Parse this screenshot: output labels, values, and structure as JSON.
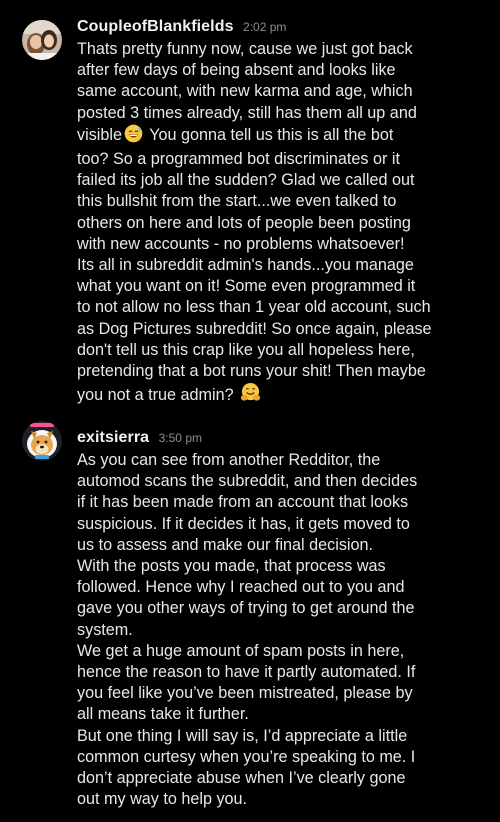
{
  "colors": {
    "background": "#000000",
    "username": "#f2f2f2",
    "timestamp": "#8e8e8e",
    "text": "#e8e8e8"
  },
  "messages": [
    {
      "username": "CoupleofBlankfields",
      "time": "2:02 pm",
      "avatar_icon": "couple-photo-avatar",
      "lines": [
        "Thats pretty funny now, cause we just got back",
        "after few days of being absent and looks like",
        "same account, with new karma and age, which",
        "posted 3 times already, still has them all up and",
        "visible",
        " You gonna tell us this is all the bot",
        "too? So a programmed bot discriminates or it",
        "failed its job all the sudden? Glad we called out",
        "this bullshit from the start...we even talked to",
        "others on here and lots of people been posting",
        "with new accounts - no problems whatsoever!",
        "Its all in subreddit admin's hands...you manage",
        "what you want on it! Some even programmed it",
        "to not allow no less than 1 year old account, such",
        "as Dog Pictures subreddit! So once again, please",
        "don't tell us this crap like you all hopeless here,",
        "pretending that a bot runs your shit! Then maybe",
        "you not a true admin?"
      ]
    },
    {
      "username": "exitsierra",
      "time": "3:50 pm",
      "avatar_icon": "doge-snoo-avatar",
      "lines": [
        "As you can see from another Redditor, the",
        "automod scans the subreddit, and then decides",
        "if it has been made from an account that looks",
        "suspicious. If it decides it has, it gets moved to",
        "us to assess and make our final decision.",
        "With the posts you made, that process was",
        "followed. Hence why I reached out to you and",
        "gave you other ways of trying to get around the",
        "system.",
        "We get a huge amount of spam posts in here,",
        "hence the reason to have it partly automated. If",
        "you feel like you’ve been mistreated, please by",
        "all means take it further.",
        "But one thing I will say is, I’d appreciate a little",
        "common curtesy when you’re speaking to me. I",
        "don’t appreciate abuse when I’ve clearly gone",
        "out my way to help you."
      ]
    }
  ]
}
